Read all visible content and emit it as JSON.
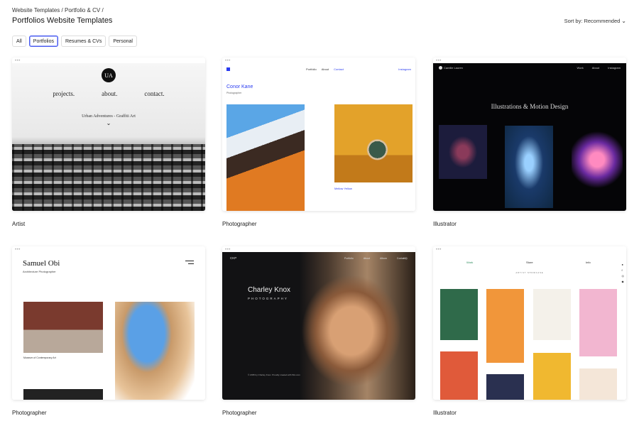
{
  "breadcrumb": [
    {
      "label": "Website Templates"
    },
    {
      "label": "Portfolio & CV"
    }
  ],
  "page_title": "Portfolios Website Templates",
  "sort": {
    "label": "Sort by:",
    "value": "Recommended"
  },
  "filters": [
    {
      "label": "All",
      "active": false
    },
    {
      "label": "Portfolios",
      "active": true
    },
    {
      "label": "Resumes & CVs",
      "active": false
    },
    {
      "label": "Personal",
      "active": false
    }
  ],
  "templates": [
    {
      "label": "Artist",
      "preview": {
        "logo": "UA",
        "nav": [
          "projects.",
          "about.",
          "contact."
        ],
        "subtitle": "Urban Adventures - Graffiti Art"
      }
    },
    {
      "label": "Photographer",
      "preview": {
        "nav": [
          "Portfolio",
          "About",
          "Contact"
        ],
        "instagram": "Instagram",
        "name": "Conor Kane",
        "role": "Photographer",
        "caption": "Mellow Yellow"
      }
    },
    {
      "label": "Illustrator",
      "preview": {
        "brand": "Camille Lauren",
        "nav": [
          "Work",
          "About",
          "Instagram"
        ],
        "headline": "Illustrations & Motion Design"
      }
    },
    {
      "label": "Photographer",
      "preview": {
        "name": "Samuel Obi",
        "role": "Architecture Photographer",
        "caption": "Museum of Contemporary Art"
      }
    },
    {
      "label": "Photographer",
      "preview": {
        "logo": "CKP",
        "nav": [
          "Portfolio",
          "About",
          "Album",
          "Contact"
        ],
        "social": "f  ◎",
        "name": "Charley Knox",
        "role": "PHOTOGRAPHY",
        "footer": "© 2035 by Charley Knox. Proudly created with Wix.com"
      }
    },
    {
      "label": "Illustrator",
      "preview": {
        "nav": [
          "Work",
          "Store",
          "Info"
        ],
        "heading": "ARTIST SHOWCASE"
      }
    }
  ],
  "colors": {
    "accent": "#4a5cf0",
    "photographer_blue": "#2a3cf0"
  }
}
